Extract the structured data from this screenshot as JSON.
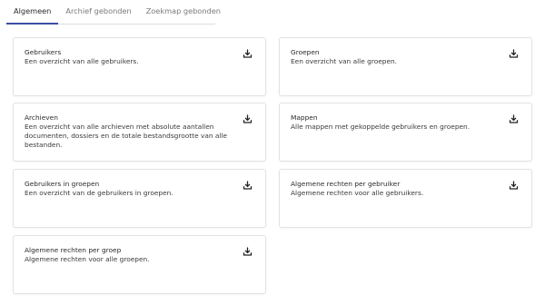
{
  "tabs": [
    {
      "label": "Algemeen",
      "active": true
    },
    {
      "label": "Archief gebonden",
      "active": false
    },
    {
      "label": "Zoekmap gebonden",
      "active": false
    }
  ],
  "cards": [
    {
      "title": "Gebruikers",
      "description": "Een overzicht van alle gebruikers.",
      "icon": "download-icon"
    },
    {
      "title": "Groepen",
      "description": "Een overzicht van alle groepen.",
      "icon": "download-icon"
    },
    {
      "title": "Archieven",
      "description": "Een overzicht van alle archieven met absolute aantallen documenten, dossiers en de totale bestandsgrootte van alle bestanden.",
      "icon": "download-icon"
    },
    {
      "title": "Mappen",
      "description": "Alle mappen met gekoppelde gebruikers en groepen.",
      "icon": "download-icon"
    },
    {
      "title": "Gebruikers in groepen",
      "description": "Een overzicht van de gebruikers in groepen.",
      "icon": "download-icon"
    },
    {
      "title": "Algemene rechten per gebruiker",
      "description": "Algemene rechten voor alle gebruikers.",
      "icon": "download-icon"
    },
    {
      "title": "Algemene rechten per groep",
      "description": "Algemene rechten voor alle groepen.",
      "icon": "download-icon"
    }
  ],
  "colors": {
    "accent": "#3b4ea6",
    "border": "#e2e2e2",
    "text": "#2d2d2d"
  }
}
